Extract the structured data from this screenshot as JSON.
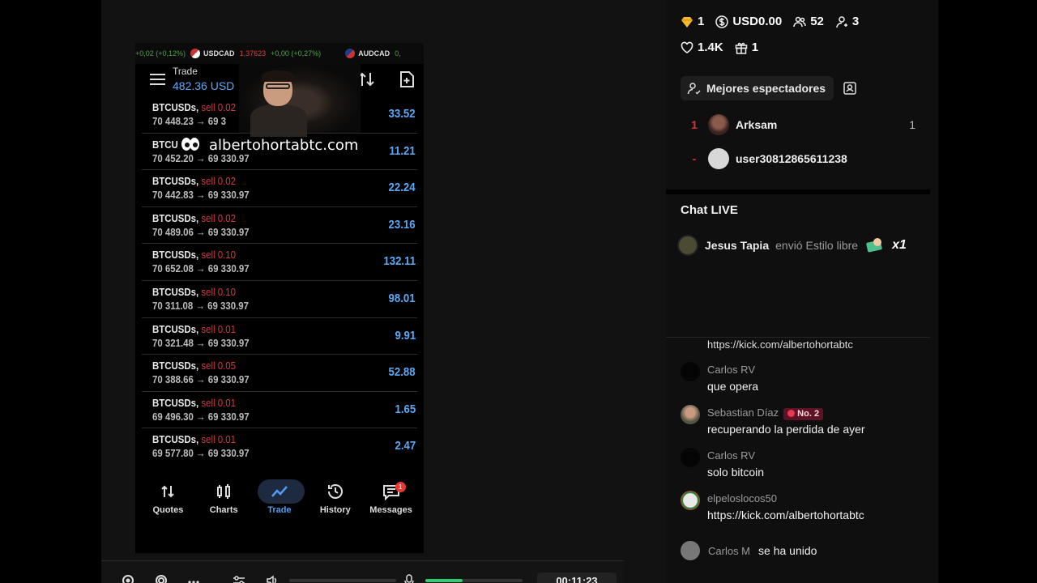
{
  "ticker": {
    "item1_change": "+0,02 (+0,12%)",
    "item2_symbol": "USDCAD",
    "item2_price": "1,37623",
    "item2_change": "+0,00 (+0,27%)",
    "item3_symbol": "AUDCAD",
    "item3_change": "0,"
  },
  "app": {
    "title": "Trade",
    "balance": "482.36 USD"
  },
  "trades": [
    {
      "symbol": "BTCUSDs,",
      "side": "sell 0.02",
      "open": "70 448.23",
      "arrow": "→",
      "current": "69 3",
      "profit": "33.52"
    },
    {
      "symbol": "BTCU",
      "side": "",
      "open": "70 452.20",
      "arrow": "→",
      "current": "69 330.97",
      "profit": "11.21"
    },
    {
      "symbol": "BTCUSDs,",
      "side": "sell 0.02",
      "open": "70 442.83",
      "arrow": "→",
      "current": "69 330.97",
      "profit": "22.24"
    },
    {
      "symbol": "BTCUSDs,",
      "side": "sell 0.02",
      "open": "70 489.06",
      "arrow": "→",
      "current": "69 330.97",
      "profit": "23.16"
    },
    {
      "symbol": "BTCUSDs,",
      "side": "sell 0.10",
      "open": "70 652.08",
      "arrow": "→",
      "current": "69 330.97",
      "profit": "132.11"
    },
    {
      "symbol": "BTCUSDs,",
      "side": "sell 0.10",
      "open": "70 311.08",
      "arrow": "→",
      "current": "69 330.97",
      "profit": "98.01"
    },
    {
      "symbol": "BTCUSDs,",
      "side": "sell 0.01",
      "open": "70 321.48",
      "arrow": "→",
      "current": "69 330.97",
      "profit": "9.91"
    },
    {
      "symbol": "BTCUSDs,",
      "side": "sell 0.05",
      "open": "70 388.66",
      "arrow": "→",
      "current": "69 330.97",
      "profit": "52.88"
    },
    {
      "symbol": "BTCUSDs,",
      "side": "sell 0.01",
      "open": "69 496.30",
      "arrow": "→",
      "current": "69 330.97",
      "profit": "1.65"
    },
    {
      "symbol": "BTCUSDs,",
      "side": "sell 0.01",
      "open": "69 577.80",
      "arrow": "→",
      "current": "69 330.97",
      "profit": "2.47"
    }
  ],
  "watermark": "albertohortabtc.com",
  "nav": {
    "quotes": "Quotes",
    "charts": "Charts",
    "trade": "Trade",
    "history": "History",
    "messages": "Messages",
    "messages_badge": "1"
  },
  "player": {
    "timer": "00:11:23",
    "mic_level_percent": 38
  },
  "stats": {
    "gems": "1",
    "balance": "USD0.00",
    "viewers": "52",
    "followers": "3",
    "likes": "1.4K",
    "gifts": "1"
  },
  "top_viewers": {
    "button_label": "Mejores espectadores",
    "rows": [
      {
        "rank": "1",
        "name": "Arksam",
        "count": "1"
      },
      {
        "rank": "-",
        "name": "user30812865611238",
        "count": ""
      }
    ]
  },
  "chat": {
    "title": "Chat LIVE",
    "gift": {
      "user": "Jesus Tapia",
      "verb": "envió Estilo libre",
      "multiplier": "x1"
    },
    "partial_text": "https://kick.com/albertohortabtc",
    "messages": [
      {
        "user": "Carlos RV",
        "text": "que opera"
      },
      {
        "user": "Sebastian Díaz",
        "badge": "No. 2",
        "text": "recuperando la perdida de ayer"
      },
      {
        "user": "Carlos RV",
        "text": "solo bitcoin"
      },
      {
        "user": "elpeloslocos50",
        "text": "https://kick.com/albertohortabtc"
      }
    ],
    "join": {
      "user": "Carlos M",
      "text": "se ha unido"
    }
  },
  "colors": {
    "accent_blue": "#5aa8f5",
    "sell_red": "#e0343b",
    "rank_red": "#e03040",
    "mic_green": "#2ecc71"
  }
}
